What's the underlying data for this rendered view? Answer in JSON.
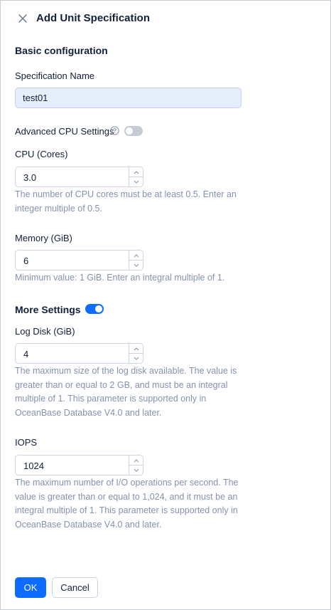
{
  "dialog": {
    "title": "Add Unit Specification"
  },
  "basic": {
    "section_title": "Basic configuration",
    "spec_name_label": "Specification Name",
    "spec_name_value": "test01",
    "advanced_cpu_label": "Advanced CPU Settings",
    "advanced_cpu_enabled": false
  },
  "cpu": {
    "label": "CPU (Cores)",
    "value": "3.0",
    "help": "The number of CPU cores must be at least 0.5. Enter an integer multiple of 0.5."
  },
  "memory": {
    "label": "Memory (GiB)",
    "value": "6",
    "help": "Minimum value: 1 GiB. Enter an integral multiple of 1."
  },
  "more": {
    "section_title": "More Settings",
    "enabled": true
  },
  "log_disk": {
    "label": "Log Disk (GiB)",
    "value": "4",
    "help": "The maximum size of the log disk available. The value is greater than or equal to 2 GB, and must be an integral multiple of 1. This parameter is supported only in OceanBase Database V4.0 and later."
  },
  "iops": {
    "label": "IOPS",
    "value": "1024",
    "help": "The maximum number of I/O operations per second. The value is greater than or equal to 1,024, and it must be an integral multiple of 1. This parameter is supported only in OceanBase Database V4.0 and later."
  },
  "footer": {
    "ok_label": "OK",
    "cancel_label": "Cancel"
  },
  "colors": {
    "accent": "#0d6cff",
    "toggle_off": "#c5cbd6",
    "help_text": "#8592ad",
    "input_fill": "#e6eefc"
  }
}
